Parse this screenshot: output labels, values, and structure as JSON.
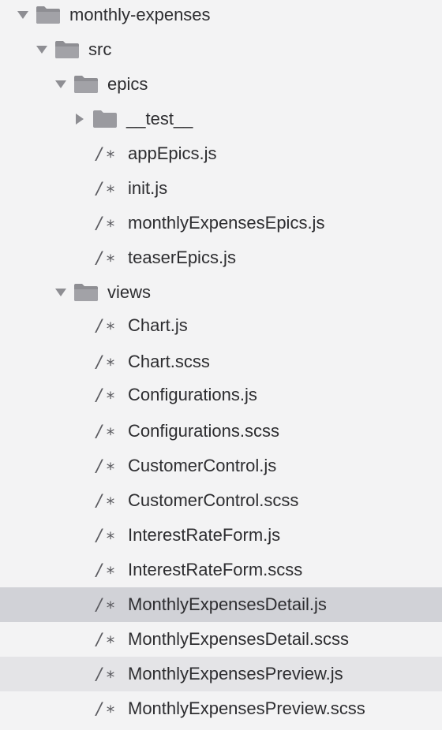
{
  "tree": {
    "root": {
      "label": "monthly-expenses",
      "expanded": true,
      "icon": "folder-open-icon"
    },
    "src": {
      "label": "src",
      "expanded": true,
      "icon": "folder-open-icon"
    },
    "epics": {
      "label": "epics",
      "expanded": true,
      "icon": "folder-open-icon"
    },
    "test": {
      "label": "__test__",
      "expanded": false,
      "icon": "folder-closed-icon"
    },
    "epics_files": [
      {
        "label": "appEpics.js",
        "icon_glyph": "/∗"
      },
      {
        "label": "init.js",
        "icon_glyph": "/∗"
      },
      {
        "label": "monthlyExpensesEpics.js",
        "icon_glyph": "/∗"
      },
      {
        "label": "teaserEpics.js",
        "icon_glyph": "/∗"
      }
    ],
    "views": {
      "label": "views",
      "expanded": true,
      "icon": "folder-open-icon"
    },
    "views_files": [
      {
        "label": "Chart.js",
        "icon_glyph": "/∗"
      },
      {
        "label": "Chart.scss",
        "icon_glyph": "/∗"
      },
      {
        "label": "Configurations.js",
        "icon_glyph": "/∗"
      },
      {
        "label": "Configurations.scss",
        "icon_glyph": "/∗"
      },
      {
        "label": "CustomerControl.js",
        "icon_glyph": "/∗"
      },
      {
        "label": "CustomerControl.scss",
        "icon_glyph": "/∗"
      },
      {
        "label": "InterestRateForm.js",
        "icon_glyph": "/∗"
      },
      {
        "label": "InterestRateForm.scss",
        "icon_glyph": "/∗"
      },
      {
        "label": "MonthlyExpensesDetail.js",
        "icon_glyph": "/∗",
        "state": "selected"
      },
      {
        "label": "MonthlyExpensesDetail.scss",
        "icon_glyph": "/∗"
      },
      {
        "label": "MonthlyExpensesPreview.js",
        "icon_glyph": "/∗",
        "state": "hovered"
      },
      {
        "label": "MonthlyExpensesPreview.scss",
        "icon_glyph": "/∗"
      }
    ]
  },
  "colors": {
    "background": "#f3f3f4",
    "selected_row": "#d1d2d7",
    "hovered_row": "#e4e4e7",
    "text": "#2d2d30",
    "icon": "#8e8e93"
  }
}
